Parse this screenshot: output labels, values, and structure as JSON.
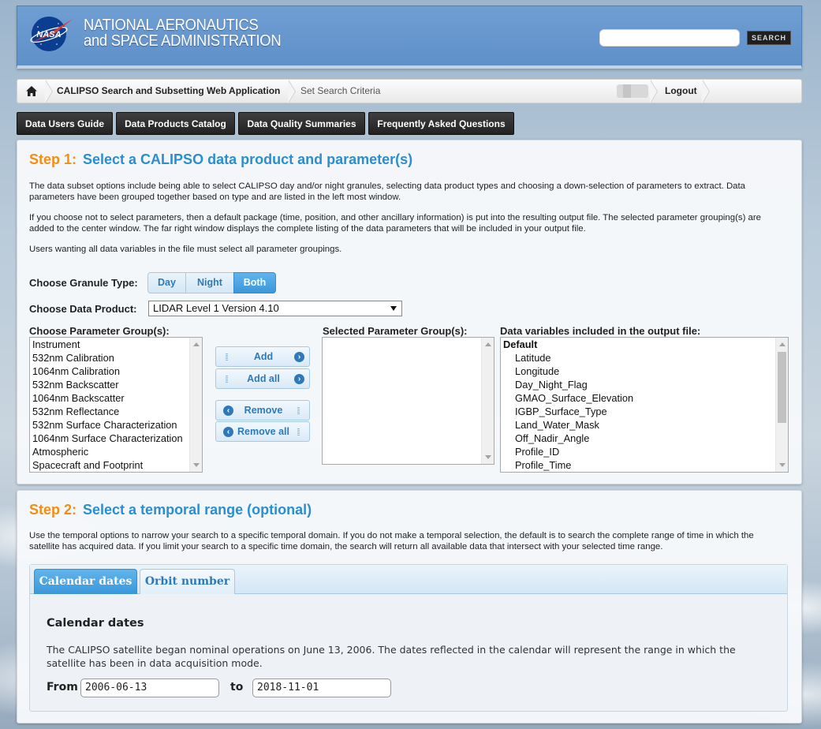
{
  "header": {
    "agency_line1": "NATIONAL AERONAUTICS",
    "agency_line2": "and SPACE ADMINISTRATION",
    "logo_text": "NASA",
    "search_placeholder": "",
    "search_button": "SEARCH"
  },
  "breadcrumb": {
    "app": "CALIPSO Search and Subsetting Web Application",
    "current": "Set Search Criteria",
    "logout": "Logout"
  },
  "nav": [
    "Data Users Guide",
    "Data Products Catalog",
    "Data Quality Summaries",
    "Frequently Asked Questions"
  ],
  "step1": {
    "number": "Step 1:",
    "title": "Select a CALIPSO data product and parameter(s)",
    "para1": "The data subset options include being able to select CALIPSO day and/or night granules, selecting data product types and choosing a down-selection of parameters to extract. Data parameters have been grouped together based on type and are listed in the left most window.",
    "para2": "If you choose not to select parameters, then a default package (time, position, and other ancillary information) is put into the resulting output file. The selected parameter grouping(s) are added to the center window. The far right window displays the complete listing of the data parameters that will be included in your output file.",
    "para3": "Users wanting all data variables in the file must select all parameter groupings.",
    "granule_label": "Choose Granule Type:",
    "granule_options": [
      "Day",
      "Night",
      "Both"
    ],
    "granule_selected": "Both",
    "product_label": "Choose Data Product:",
    "product_value": "LIDAR Level 1 Version 4.10",
    "groups_label": "Choose Parameter Group(s):",
    "groups": [
      "Instrument",
      "532nm Calibration",
      "1064nm Calibration",
      "532nm Backscatter",
      "1064nm Backscatter",
      "532nm Reflectance",
      "532nm Surface Characterization",
      "1064nm Surface Characterization",
      "Atmospheric",
      "Spacecraft and Footprint"
    ],
    "buttons": {
      "add": "Add",
      "add_all": "Add all",
      "remove": "Remove",
      "remove_all": "Remove all"
    },
    "selected_label": "Selected Parameter Group(s):",
    "output_label": "Data variables included in the output file:",
    "output_header": "Default",
    "output_vars": [
      "Latitude",
      "Longitude",
      "Day_Night_Flag",
      "GMAO_Surface_Elevation",
      "IGBP_Surface_Type",
      "Land_Water_Mask",
      "Off_Nadir_Angle",
      "Profile_ID",
      "Profile_Time"
    ]
  },
  "step2": {
    "number": "Step 2:",
    "title": "Select a temporal range (optional)",
    "para": "Use the temporal options to narrow your search to a specific temporal domain. If you do not make a temporal selection, the default is to search the complete range of time in which the satellite has acquired data. If you limit your search to a specific time domain, the search will return all available data that intersect with your selected time range.",
    "tabs": [
      "Calendar dates",
      "Orbit number"
    ],
    "active_tab": "Calendar dates",
    "section_title": "Calendar dates",
    "section_text": "The CALIPSO satellite began nominal operations on June 13, 2006. The dates reflected in the calendar will represent the range in which the satellite has been in data acquisition mode.",
    "from_label": "From",
    "from_value": "2006-06-13",
    "to_label": "to",
    "to_value": "2018-11-01"
  },
  "colors": {
    "header_blue": "#6f9ed3",
    "step_orange": "#f28e13",
    "step_blue": "#2a8fd0",
    "active_blue": "#3a97da"
  }
}
